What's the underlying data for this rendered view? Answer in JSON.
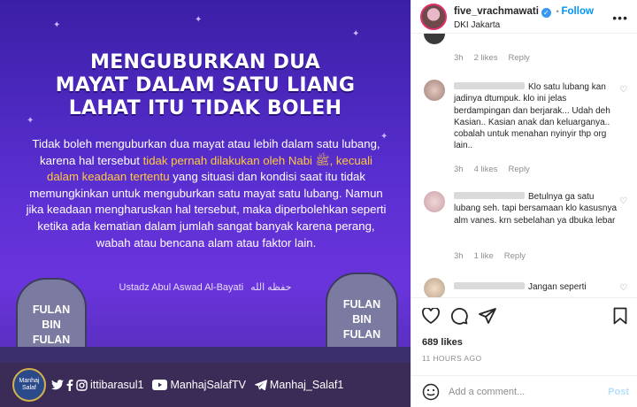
{
  "post_image": {
    "headline_lines": [
      "MENGUBURKAN DUA",
      "MAYAT DALAM SATU LIANG",
      "LAHAT ITU TIDAK BOLEH"
    ],
    "body_part1": "Tidak boleh menguburkan dua mayat atau lebih dalam satu lubang, karena hal tersebut ",
    "body_highlight": "tidak pernah dilakukan oleh Nabi ﷺ, kecuali dalam keadaan tertentu",
    "body_part2": " yang situasi dan kondisi saat itu tidak memungkinkan untuk menguburkan satu mayat satu lubang. Namun jika keadaan mengharuskan hal tersebut, maka diperbolehkan seperti ketika ada kematian dalam jumlah sangat banyak karena perang, wabah atau bencana alam atau faktor lain.",
    "author": "Ustadz Abul Aswad Al-Bayati",
    "author_arabic": "حفظه الله",
    "grave_left": [
      "FULAN",
      "BIN",
      "FULAN"
    ],
    "grave_right": [
      "FULAN",
      "BIN",
      "FULAN"
    ],
    "logo_text": "Manhaj Salaf",
    "social_handle1": "ittibarasul1",
    "social_handle2": "ManhajSalafTV",
    "social_handle3": "Manhaj_Salaf1"
  },
  "header": {
    "username": "five_vrachmawati",
    "follow_label": "Follow",
    "location": "DKI Jakarta",
    "more_label": "•••"
  },
  "comments": [
    {
      "text": "",
      "time": "3h",
      "likes": "2 likes",
      "reply": "Reply"
    },
    {
      "text": "Klo satu lubang kan jadinya dtumpuk. klo ini jelas berdampingan dan berjarak... Udah deh Kasian.. Kasian anak dan keluarganya.. cobalah untuk menahan nyinyir thp org lain..",
      "time": "3h",
      "likes": "4 likes",
      "reply": "Reply"
    },
    {
      "text": "Betulnya ga satu lubang seh. tapi bersamaan klo kasusnya alm vanes. krn sebelahan ya dbuka lebar",
      "time": "3h",
      "likes": "1 like",
      "reply": "Reply"
    },
    {
      "text": "Jangan seperti"
    }
  ],
  "likes_count": "689 likes",
  "time_ago": "11 HOURS AGO",
  "add_comment": {
    "placeholder": "Add a comment...",
    "post_label": "Post"
  },
  "colors": {
    "accent": "#0095f6",
    "highlight": "#ffc93c",
    "post_bg": "#5a2fd1"
  }
}
